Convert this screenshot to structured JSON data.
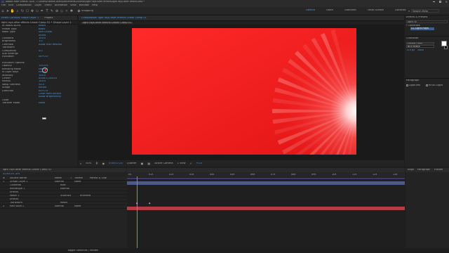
{
  "window": {
    "title": "Adobe After Effects 2020 - C:\\Users\\Hamza Azmi\\Documents\\Tutorial\\light rays after effects\\light rays after effects.aep *"
  },
  "menu": [
    "File",
    "Edit",
    "Composition",
    "Layer",
    "Effect",
    "Animation",
    "View",
    "Window",
    "Help"
  ],
  "toolbar": {
    "snapping": "Snapping"
  },
  "workspaces": [
    "Default",
    "Learn",
    "Standard",
    "Small Screen",
    "Libraries"
  ],
  "search_help": {
    "placeholder": "Search Help"
  },
  "effect_controls": {
    "tab": "Effect Controls  Shape Layer 1",
    "project_tab": "Project",
    "header": "light rays after effects Linear Comp 01 • Shape Layer 1",
    "rows": [
      {
        "label": "fx  Radial Burst",
        "value": "Reset"
      },
      {
        "label": "Preset Type",
        "value": "Basic"
      },
      {
        "label": "Mask Type",
        "value": "Soft Linear"
      },
      {
        "label": "",
        "value": "Invert"
      },
      {
        "label": "Constant",
        "value": "100.0"
      },
      {
        "label": "Brightness",
        "value": "1.0"
      },
      {
        "label": "Overflow",
        "value": "Allow HDR Results"
      },
      {
        "label": "Transform",
        "value": ""
      },
      {
        "label": "Complexity",
        "value": "4.0"
      },
      {
        "label": "Sub Settings",
        "value": ""
      },
      {
        "label": "Evolution",
        "value": "0x+0.0°"
      },
      {
        "label": "",
        "value": ""
      },
      {
        "label": "Evolution Options",
        "value": ""
      },
      {
        "label": "Opacity",
        "value": "100.0%"
      },
      {
        "label": "Blending Mode",
        "value": "Normal"
      },
      {
        "label": "fx  Light Rays",
        "value": "Reset"
      },
      {
        "label": "Intensity",
        "value": "100.0"
      },
      {
        "label": "Center",
        "value": "4358.0,1440.0"
      },
      {
        "label": "Radius",
        "value": "100.0"
      },
      {
        "label": "Warp Softness",
        "value": "50.0"
      },
      {
        "label": "Shape",
        "value": "Round"
      },
      {
        "label": "Direction",
        "value": "0x+0.0°"
      },
      {
        "label": "",
        "value": "Color from Source"
      },
      {
        "label": "",
        "value": "Allow Brightening"
      },
      {
        "label": "Color",
        "value": ""
      },
      {
        "label": "Transfer Mode",
        "value": "None"
      }
    ]
  },
  "composition": {
    "tab": "Composition  light rays after effects Linear Comp 01",
    "subtab": "light rays after effects Linear Comp 01",
    "footer": {
      "zoom": "50%",
      "timecode": "0;00;07;24",
      "quality": "Quarter",
      "camera": "Active Camera",
      "view": "1 View",
      "offset": "+0.0"
    }
  },
  "right_panel": {
    "effects_presets": "Effects & Presets",
    "search_value": "light ra",
    "category": "* Generate",
    "item": "CC Light Rays",
    "character": "Character",
    "font": "Segoe Sans",
    "font_style": "800 Black",
    "font_size": "114 px",
    "leading": "Auto",
    "paragraph": "Paragraph",
    "ligatures": "Ligatures",
    "hindi_digits": "Hindi Digits"
  },
  "timeline": {
    "tab": "light rays after effects Linear Comp 01",
    "timecode": "0;00;07;24",
    "columns": [
      "#",
      "Source Name",
      "Mode",
      "T",
      "TrkMat",
      "Parent & Link"
    ],
    "layers": [
      {
        "num": "1",
        "name": "Shape Layer 1",
        "mode": "Normal",
        "parent": "None"
      },
      {
        "num": "",
        "name": "Contents",
        "mode": "Add:",
        "parent": ""
      },
      {
        "num": "",
        "name": "Rectangle 1",
        "mode": "Normal",
        "parent": ""
      },
      {
        "num": "",
        "name": "Effects",
        "mode": "",
        "parent": ""
      },
      {
        "num": "",
        "name": "Wave 1",
        "mode": "Subtract",
        "parent": "Inverted"
      },
      {
        "num": "",
        "name": "Effects",
        "mode": "",
        "parent": ""
      },
      {
        "num": "",
        "name": "Transform",
        "mode": "Reset",
        "parent": ""
      },
      {
        "num": "2",
        "name": "Red Solid 1",
        "mode": "Normal",
        "parent": "None"
      }
    ],
    "ruler": [
      "0s",
      "01s",
      "02s",
      "03s",
      "04s",
      "05s",
      "06s",
      "07s",
      "08s",
      "09s",
      "10s",
      "11s",
      "12s",
      "13s"
    ],
    "toggle": "Toggle Switches / Modes"
  },
  "right_timeline": {
    "tabs": [
      "Align",
      "Paragraph",
      "Tracker"
    ],
    "tab_active": "Align"
  },
  "colors": {
    "accent": "#4d9ae6",
    "comp_red": "#f01818",
    "layer_blue": "#4c5a8a",
    "layer_red": "#b24040"
  }
}
